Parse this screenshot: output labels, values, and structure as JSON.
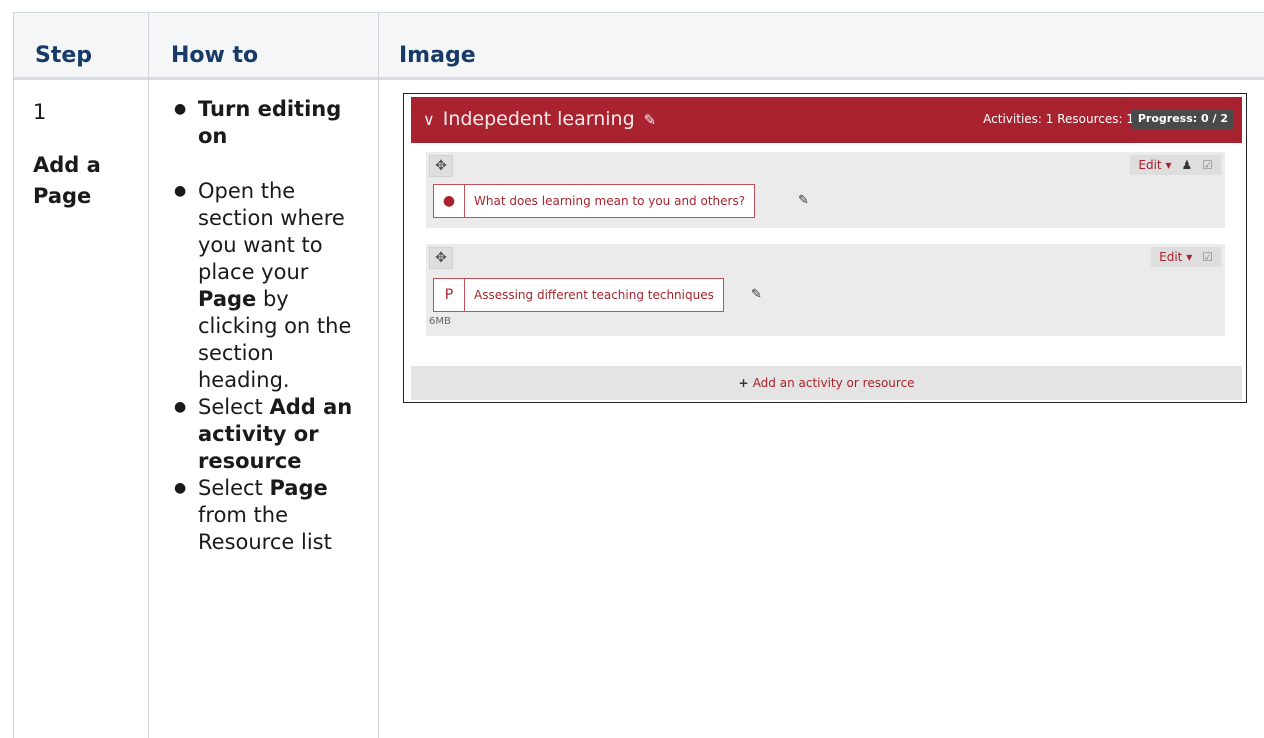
{
  "table": {
    "headers": [
      "Step",
      "How to",
      "Image"
    ],
    "step_number": "1",
    "step_title": "Add a Page",
    "howto": {
      "item1": "Turn editing on",
      "item2_a": "Open the section where you want to place your ",
      "item2_b": "Page",
      "item2_c": " by clicking on the section heading.",
      "item3_a": "Select ",
      "item3_b": "Add an activity or resource",
      "item4_a": "Select ",
      "item4_b": "Page",
      "item4_c": " from the Resource list"
    }
  },
  "screenshot": {
    "section_title": "Indepedent learning",
    "stats": "Activities: 1  Resources: 1",
    "progress": "Progress: 0 / 2",
    "edit_label": "Edit",
    "activity1": "What does learning mean to you and others?",
    "activity2": "Assessing different teaching techniques",
    "activity2_size": "6MB",
    "add_label": "Add an activity or resource"
  },
  "colors": {
    "header_text": "#173a66",
    "moodle_red": "#a8232f"
  }
}
